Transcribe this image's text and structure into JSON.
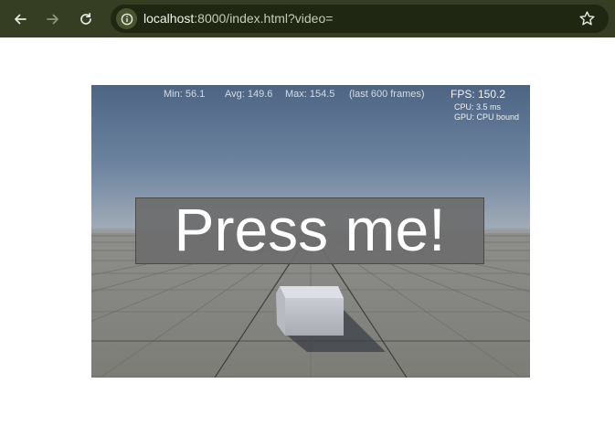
{
  "browser": {
    "url_host": "localhost",
    "url_rest": ":8000/index.html?video=",
    "icons": {
      "back": "arrow-left-icon",
      "forward": "arrow-right-icon",
      "reload": "reload-icon",
      "site_info": "info-icon",
      "bookmark": "star-icon"
    }
  },
  "game": {
    "stats": {
      "min": "Min: 56.1",
      "avg": "Avg: 149.6",
      "max": "Max: 154.5",
      "range": "(last 600 frames)",
      "fps": "FPS: 150.2",
      "cpu": "CPU: 3.5 ms",
      "gpu": "GPU: CPU bound"
    },
    "button_label": "Press me!"
  },
  "colors": {
    "toolbar": "#353d22",
    "omnibox": "#1f2713",
    "sky_top": "#4e6685",
    "sky_horizon": "#9aa6b2",
    "floor": "#8a8a84"
  }
}
